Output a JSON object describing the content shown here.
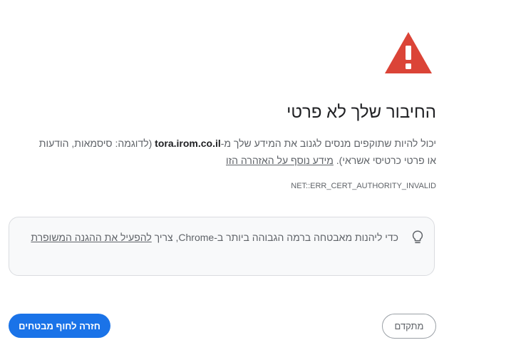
{
  "header": {
    "icon": "warning-triangle-icon",
    "icon_color": "#db4437",
    "title": "החיבור שלך לא פרטי"
  },
  "description": {
    "text_before": "יכול להיות שתוקפים מנסים לגנוב את המידע שלך מ-",
    "domain": "tora.irom.co.il",
    "text_after": " (לדוגמה: סיסמאות, הודעות או פרטי כרטיסי אשראי). ",
    "learn_more_link": "מידע נוסף על האזהרה הזו"
  },
  "error_code": "NET::ERR_CERT_AUTHORITY_INVALID",
  "enhanced_protection": {
    "icon": "lightbulb-icon",
    "text": "כדי ליהנות מאבטחה ברמה הגבוהה ביותר ב-Chrome, צריך ",
    "link": "להפעיל את ההגנה המשופרת"
  },
  "buttons": {
    "back_to_safety": "חזרה לחוף מבטחים",
    "advanced": "מתקדם"
  },
  "colors": {
    "primary": "#1a73e8",
    "danger": "#db4437",
    "text_secondary": "#5f6368"
  }
}
